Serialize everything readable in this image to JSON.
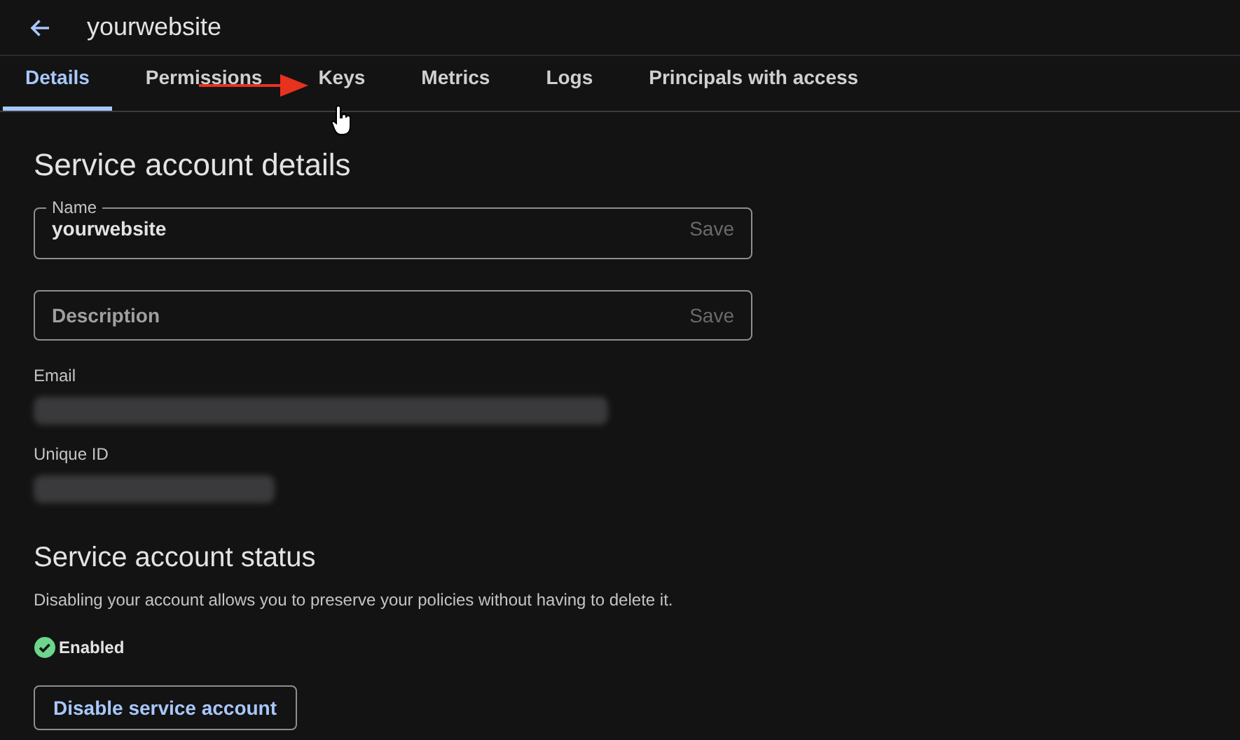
{
  "header": {
    "title": "yourwebsite"
  },
  "tabs": [
    {
      "label": "Details",
      "selected": true
    },
    {
      "label": "Permissions",
      "selected": false
    },
    {
      "label": "Keys",
      "selected": false
    },
    {
      "label": "Metrics",
      "selected": false
    },
    {
      "label": "Logs",
      "selected": false
    },
    {
      "label": "Principals with access",
      "selected": false
    }
  ],
  "details": {
    "heading": "Service account details",
    "fields": [
      {
        "label": "Name",
        "value": "yourwebsite",
        "action": "Save"
      },
      {
        "placeholder": "Description",
        "action": "Save"
      }
    ],
    "redacted": [
      {
        "label": "Email",
        "kind": "long"
      },
      {
        "label": "Unique ID",
        "kind": "short"
      }
    ]
  },
  "status": {
    "heading": "Service account status",
    "description": "Disabling your account allows you to preserve your policies without having to delete it.",
    "enabled": true,
    "state_label": "Enabled",
    "button": "Disable service account"
  }
}
